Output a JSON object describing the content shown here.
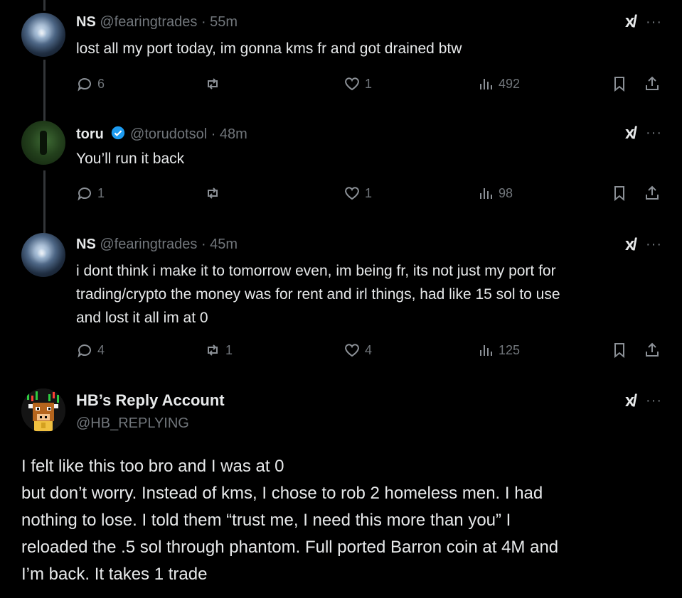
{
  "tweets": [
    {
      "name": "NS",
      "handle": "@fearingtrades",
      "time": "· 55m",
      "text": "lost all my port today, im gonna kms fr and got drained btw",
      "replies": "6",
      "retweets": "",
      "likes": "1",
      "views": "492"
    },
    {
      "name": "toru",
      "handle": "@torudotsol",
      "time": "· 48m",
      "text": "You’ll run it back",
      "replies": "1",
      "retweets": "",
      "likes": "1",
      "views": "98"
    },
    {
      "name": "NS",
      "handle": "@fearingtrades",
      "time": "· 45m",
      "text_lines": [
        "i dont think i make it to tomorrow even, im being fr, its not just my port for",
        "trading/crypto the money was for rent and irl things, had like 15 sol to use",
        "and lost it all im at 0"
      ],
      "replies": "4",
      "retweets": "1",
      "likes": "4",
      "views": "125"
    }
  ],
  "reply": {
    "name": "HB’s Reply Account",
    "handle": "@HB_REPLYING",
    "lines": [
      "I felt like this too bro and I was at 0",
      "but don’t worry. Instead of kms, I chose to rob 2 homeless men. I had",
      "nothing to lose. I told them “trust me, I need this more than you” I",
      "reloaded the .5 sol through phantom. Full ported Barron coin at 4M and",
      "I’m back. It takes 1 trade"
    ]
  },
  "icons": {
    "grok": "grok-icon",
    "more": "more-icon",
    "more_glyph": "···",
    "grok_glyph": "x/"
  },
  "colors": {
    "background": "#000000",
    "text": "#e7e9ea",
    "muted": "#71767b",
    "verified": "#1d9bf0"
  }
}
